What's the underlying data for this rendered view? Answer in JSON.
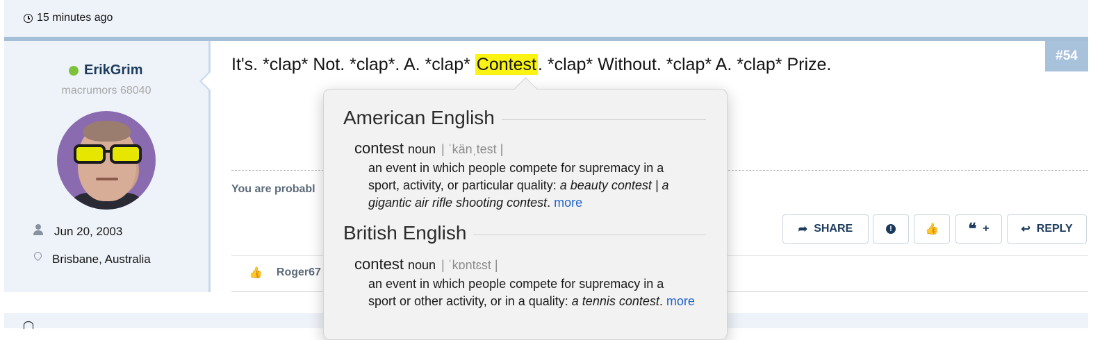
{
  "topbar": {
    "time": "15 minutes ago"
  },
  "user": {
    "name": "ErikGrim",
    "title": "macrumors 68040",
    "joined": "Jun 20, 2003",
    "location": "Brisbane, Australia"
  },
  "post": {
    "number": "#54",
    "message_before": "It's. *clap* Not. *clap*. A. *clap* ",
    "message_highlight": "Contest",
    "message_after": ". *clap* Without. *clap* A. *clap* Prize.",
    "signature_partial": "You are probabl"
  },
  "actions": {
    "share_label": "SHARE",
    "reply_label": "REPLY",
    "quote_plus": "+"
  },
  "likes": {
    "user": "Roger67"
  },
  "dictionary": {
    "sections": [
      {
        "title": "American English",
        "word": "contest",
        "pos": "noun",
        "pron": "| ˈkänˌtest |",
        "def_text": "an event in which people compete for supremacy in a sport, activity, or particular quality: ",
        "example": "a beauty contest | a gigantic air rifle shooting contest",
        "tail": ". ",
        "more": "more"
      },
      {
        "title": "British English",
        "word": "contest",
        "pos": "noun",
        "pron": "| ˈkɒntɛst |",
        "def_text": "an event in which people compete for supremacy in a sport or other activity, or in a quality: ",
        "example": "a tennis contest",
        "tail": ". ",
        "more": "more"
      }
    ]
  },
  "colors": {
    "accent": "#1c3b5c",
    "highlight": "#fbf312",
    "online": "#7ec23a",
    "postnum_bg": "#a9c2dc",
    "link": "#1f63c9"
  },
  "icons": [
    "clock-icon",
    "person-icon",
    "map-pin-icon",
    "share-icon",
    "report-icon",
    "thumbs-up-icon",
    "quote-icon",
    "reply-icon"
  ]
}
